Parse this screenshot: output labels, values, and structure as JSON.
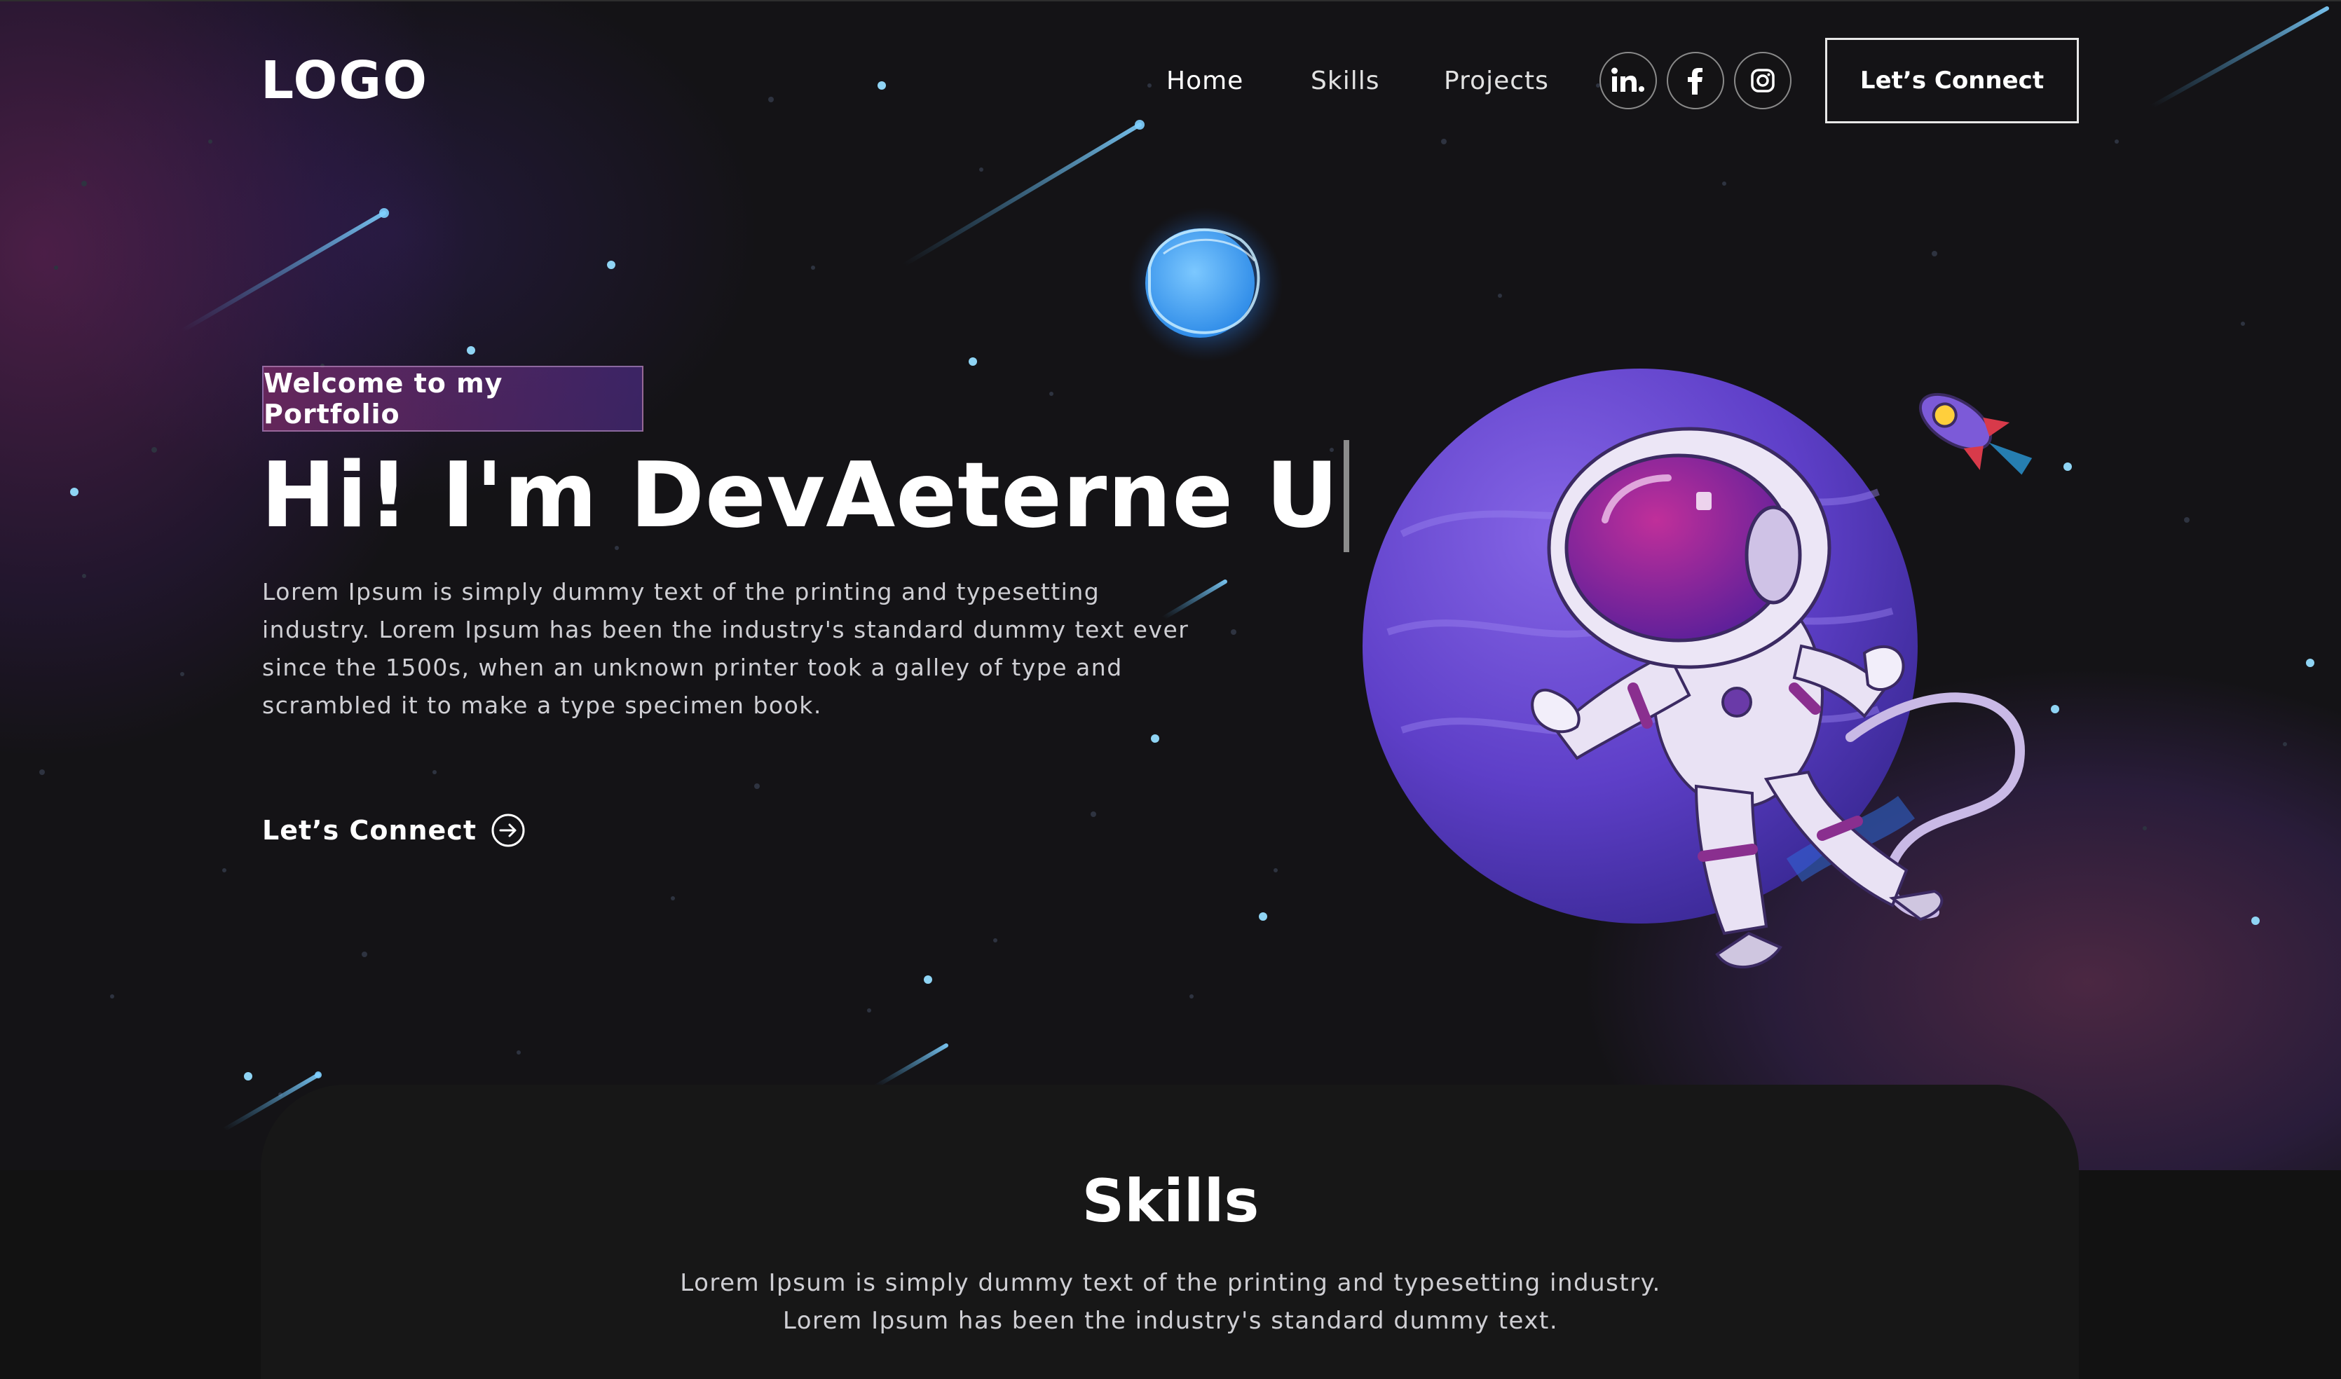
{
  "nav": {
    "logo": "LOGO",
    "links": [
      "Home",
      "Skills",
      "Projects"
    ],
    "social_icons": [
      "linkedin-icon",
      "facebook-icon",
      "instagram-icon"
    ],
    "connect_button": "Let’s Connect"
  },
  "hero": {
    "tagline": "Welcome to my Portfolio",
    "title": "Hi! I'm DevAeterne U",
    "description": "Lorem Ipsum is simply dummy text of the printing and typesetting industry. Lorem Ipsum has been the industry's standard dummy text ever since the 1500s, when an unknown printer took a galley of type and scrambled it to make a type specimen book.",
    "cta_label": "Let’s Connect",
    "cta_icon": "arrow-right-circle-icon",
    "illustration": "astronaut-planet-illustration"
  },
  "skills": {
    "title": "Skills",
    "line1": "Lorem Ipsum is simply dummy text of the printing and typesetting industry.",
    "line2": "Lorem Ipsum has been the industry's standard dummy text."
  },
  "colors": {
    "background": "#121212",
    "card": "#171717",
    "accent_purple": "#6a4bd6",
    "accent_pink": "#9c3a7e",
    "text_muted": "#cfcfd4"
  }
}
